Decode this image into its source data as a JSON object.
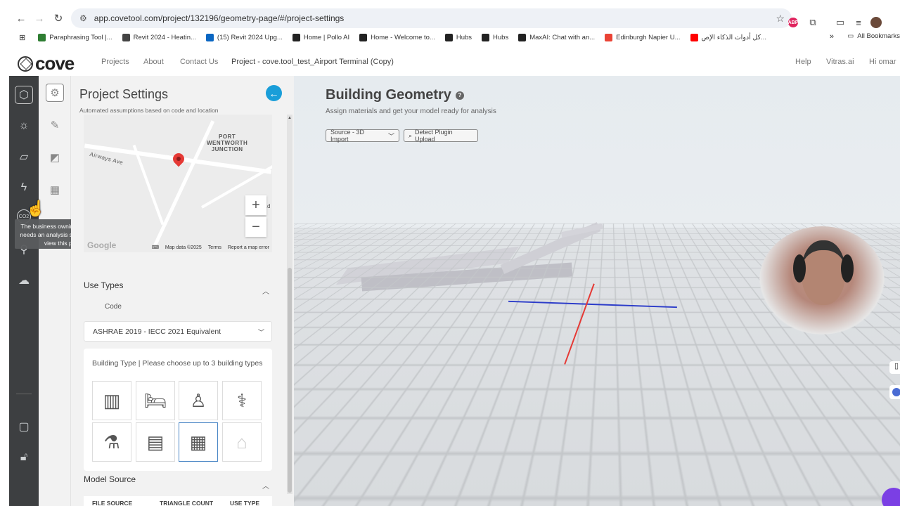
{
  "browser": {
    "url": "app.covetool.com/project/132196/geometry-page/#/project-settings",
    "bookmarks": [
      {
        "label": "Paraphrasing Tool |...",
        "color": "#2e7d32"
      },
      {
        "label": "Revit 2024 - Heatin...",
        "color": "#444444"
      },
      {
        "label": "(15) Revit 2024 Upg...",
        "color": "#0a66c2"
      },
      {
        "label": "Home | Pollo AI",
        "color": "#222222"
      },
      {
        "label": "Home - Welcome to...",
        "color": "#222222"
      },
      {
        "label": "Hubs",
        "color": "#222222"
      },
      {
        "label": "Hubs",
        "color": "#222222"
      },
      {
        "label": "MaxAI: Chat with an...",
        "color": "#222222"
      },
      {
        "label": "Edinburgh Napier U...",
        "color": "#ea4335"
      },
      {
        "label": "كل أدوات الذكاء الإص...",
        "color": "#ff0000"
      }
    ],
    "more": "»",
    "all_bookmarks": "All Bookmarks",
    "extensions": {
      "abp": "ABP"
    }
  },
  "header": {
    "logo": "cove",
    "nav": [
      "Projects",
      "About",
      "Contact Us"
    ],
    "project": "Project - cove.tool_test_Airport Terminal (Copy)",
    "right": [
      "Help",
      "Vitras.ai",
      "Hi omar"
    ]
  },
  "sidebar": {
    "tooltip": "The business owning this project needs an analysis subscription to view this page.",
    "co2": "CO2"
  },
  "panel": {
    "title": "Project Settings",
    "subtitle": "Automated assumptions based on code and location",
    "map": {
      "junction": "PORT\nWENTWORTH\nJUNCTION",
      "road": "Airways Ave",
      "road2": "ad",
      "google": "Google",
      "attribution": "Map data ©2025",
      "terms": "Terms",
      "report": "Report a map error",
      "zoom_in": "+",
      "zoom_out": "−"
    },
    "use_types": {
      "title": "Use Types",
      "code_label": "Code",
      "code_value": "ASHRAE 2019 - IECC 2021 Equivalent",
      "building_type_prompt": "Building Type | Please choose up to 3 building types"
    },
    "model_source": {
      "title": "Model Source",
      "columns": [
        "FILE SOURCE",
        "TRIANGLE COUNT",
        "USE TYPE"
      ]
    }
  },
  "viewport": {
    "title": "Building Geometry",
    "help": "?",
    "subtitle": "Assign materials and get your model ready for analysis",
    "source_select": "Source - 3D Import",
    "detect_button": "Detect Plugin Upload"
  }
}
